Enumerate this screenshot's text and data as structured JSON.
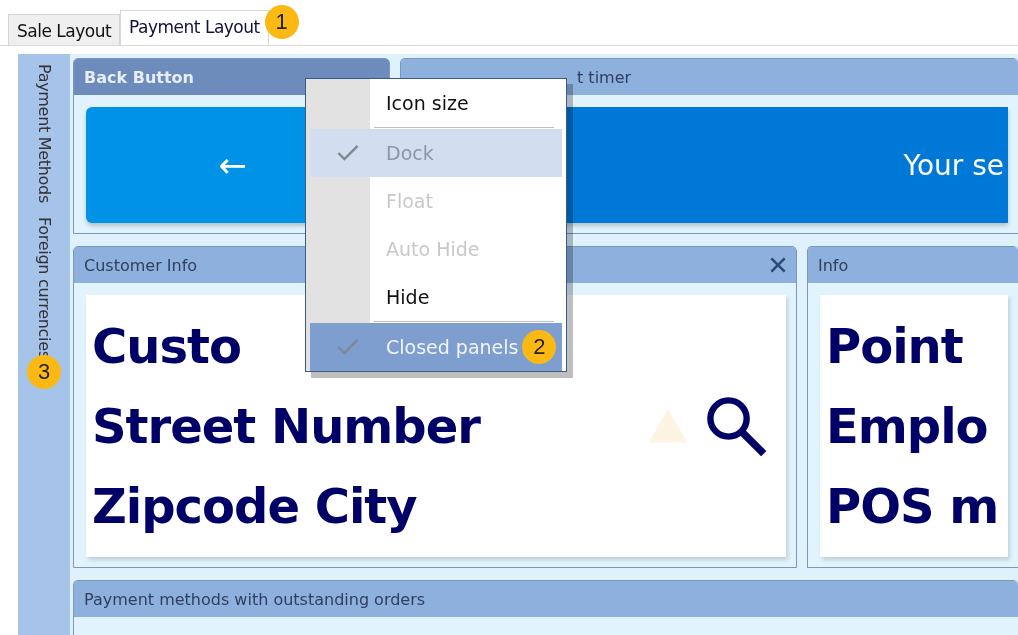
{
  "tabs": [
    {
      "label": "Sale Layout",
      "selected": false
    },
    {
      "label": "Payment Layout",
      "selected": true,
      "callout": "1"
    }
  ],
  "side_tabs": [
    {
      "label": "Payment Methods"
    },
    {
      "label": "Foreign currencies",
      "callout": "3"
    }
  ],
  "panels": {
    "back": {
      "title": "Back Button",
      "active": true,
      "button_label": "←"
    },
    "timer": {
      "title": "t timer",
      "active": false,
      "button_label": "Your se"
    },
    "customer": {
      "title": "Customer Info",
      "active": false,
      "lines": [
        "Custo",
        "Street Number",
        "Zipcode City"
      ]
    },
    "info": {
      "title": "Info",
      "active": false,
      "lines": [
        "Point",
        "Emplo",
        "POS m"
      ]
    },
    "payments": {
      "title": "Payment methods with outstanding orders",
      "active": false
    }
  },
  "context_menu": {
    "items": [
      {
        "kind": "item",
        "label": "Icon size",
        "checked": false,
        "disabled": false,
        "highlighted": false
      },
      {
        "kind": "separator"
      },
      {
        "kind": "item",
        "label": "Dock",
        "checked": true,
        "disabled": true,
        "highlighted": true
      },
      {
        "kind": "item",
        "label": "Float",
        "checked": false,
        "disabled": true,
        "highlighted": false
      },
      {
        "kind": "item",
        "label": "Auto Hide",
        "checked": false,
        "disabled": true,
        "highlighted": false
      },
      {
        "kind": "item",
        "label": "Hide",
        "checked": false,
        "disabled": false,
        "highlighted": false
      },
      {
        "kind": "separator"
      },
      {
        "kind": "item",
        "label": "Closed panels",
        "checked": true,
        "disabled": false,
        "highlighted": true,
        "callout": "2"
      }
    ]
  }
}
